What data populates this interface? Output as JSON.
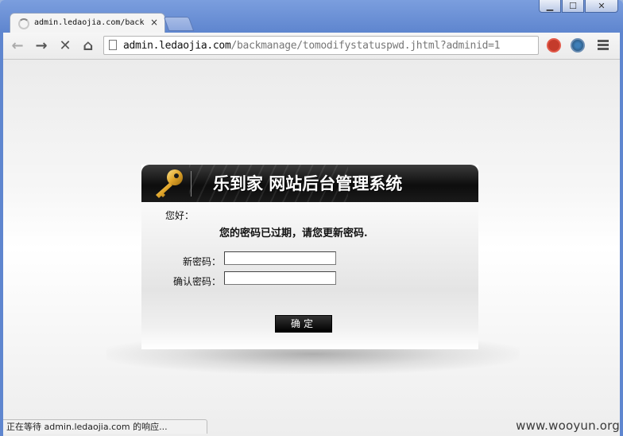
{
  "window": {
    "minimize_label": "▁",
    "maximize_label": "☐",
    "close_label": "✕"
  },
  "tab": {
    "title": "admin.ledaojia.com/back",
    "close_label": "×"
  },
  "toolbar": {
    "back_label": "←",
    "forward_label": "→",
    "stop_label": "✕",
    "home_label": "⌂",
    "url_host": "admin.ledaojia.com",
    "url_path": "/backmanage/tomodifystatuspwd.jhtml?adminid=1"
  },
  "panel": {
    "title": "乐到家 网站后台管理系统",
    "greeting": "您好：",
    "message": "您的密码已过期，请您更新密码.",
    "new_password_label": "新密码：",
    "confirm_password_label": "确认密码：",
    "new_password_value": "",
    "confirm_password_value": "",
    "submit_label": "确定"
  },
  "status": {
    "text": "正在等待 admin.ledaojia.com 的响应..."
  },
  "watermark": "www.wooyun.org",
  "colors": {
    "frame": "#5f86cf",
    "header_bg": "#0d0d0d",
    "button_bg": "#000000",
    "key_gold": "#e0a52a"
  }
}
